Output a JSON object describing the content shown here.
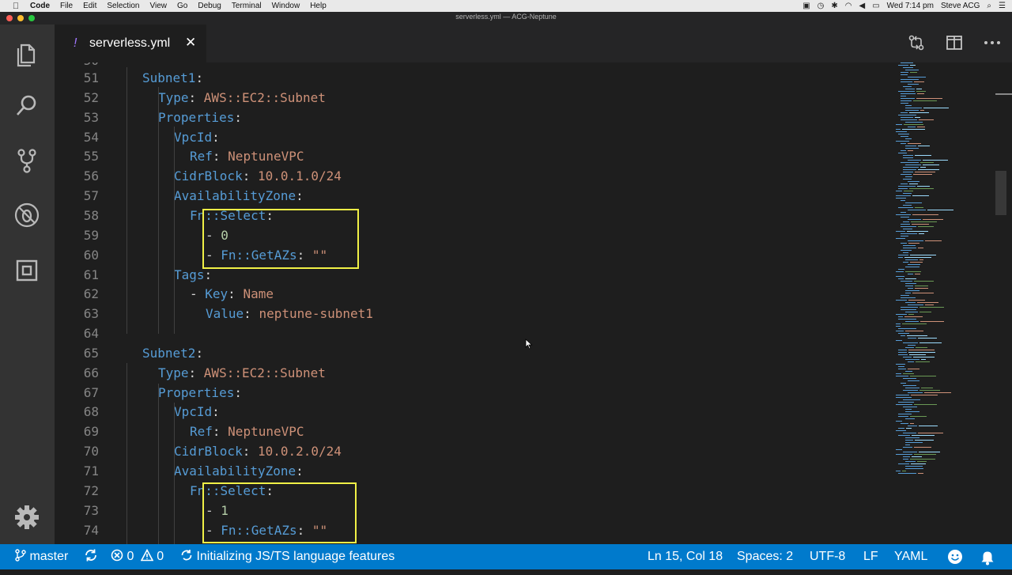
{
  "menubar": {
    "app": "Code",
    "items": [
      "File",
      "Edit",
      "Selection",
      "View",
      "Go",
      "Debug",
      "Terminal",
      "Window",
      "Help"
    ],
    "clock": "Wed 7:14 pm",
    "user": "Steve ACG"
  },
  "window": {
    "title": "serverless.yml — ACG-Neptune"
  },
  "tab": {
    "modified_mark": "!",
    "name": "serverless.yml",
    "close": "✕"
  },
  "editor": {
    "lines": [
      {
        "no": "51",
        "indent": 2,
        "tokens": [
          {
            "t": "Subnet1",
            "c": "k"
          },
          {
            "t": ":",
            "c": "p"
          }
        ]
      },
      {
        "no": "52",
        "indent": 3,
        "tokens": [
          {
            "t": "Type",
            "c": "k"
          },
          {
            "t": ": ",
            "c": "p"
          },
          {
            "t": "AWS::EC2::Subnet",
            "c": "s"
          }
        ]
      },
      {
        "no": "53",
        "indent": 3,
        "tokens": [
          {
            "t": "Properties",
            "c": "k"
          },
          {
            "t": ":",
            "c": "p"
          }
        ]
      },
      {
        "no": "54",
        "indent": 4,
        "tokens": [
          {
            "t": "VpcId",
            "c": "k"
          },
          {
            "t": ":",
            "c": "p"
          }
        ]
      },
      {
        "no": "55",
        "indent": 5,
        "tokens": [
          {
            "t": "Ref",
            "c": "k"
          },
          {
            "t": ": ",
            "c": "p"
          },
          {
            "t": "NeptuneVPC",
            "c": "s"
          }
        ]
      },
      {
        "no": "56",
        "indent": 4,
        "tokens": [
          {
            "t": "CidrBlock",
            "c": "k"
          },
          {
            "t": ": ",
            "c": "p"
          },
          {
            "t": "10.0.1.0/24",
            "c": "s"
          }
        ]
      },
      {
        "no": "57",
        "indent": 4,
        "tokens": [
          {
            "t": "AvailabilityZone",
            "c": "k"
          },
          {
            "t": ":",
            "c": "p"
          }
        ]
      },
      {
        "no": "58",
        "indent": 5,
        "tokens": [
          {
            "t": "Fn::Select",
            "c": "k"
          },
          {
            "t": ":",
            "c": "p"
          }
        ]
      },
      {
        "no": "59",
        "indent": 6,
        "tokens": [
          {
            "t": "- ",
            "c": "p"
          },
          {
            "t": "0",
            "c": "n"
          }
        ]
      },
      {
        "no": "60",
        "indent": 6,
        "tokens": [
          {
            "t": "- ",
            "c": "p"
          },
          {
            "t": "Fn::GetAZs",
            "c": "k"
          },
          {
            "t": ": ",
            "c": "p"
          },
          {
            "t": "\"\"",
            "c": "s"
          }
        ]
      },
      {
        "no": "61",
        "indent": 4,
        "tokens": [
          {
            "t": "Tags",
            "c": "k"
          },
          {
            "t": ":",
            "c": "p"
          }
        ]
      },
      {
        "no": "62",
        "indent": 5,
        "tokens": [
          {
            "t": "- ",
            "c": "p"
          },
          {
            "t": "Key",
            "c": "k"
          },
          {
            "t": ": ",
            "c": "p"
          },
          {
            "t": "Name",
            "c": "s"
          }
        ]
      },
      {
        "no": "63",
        "indent": 6,
        "tokens": [
          {
            "t": "Value",
            "c": "k"
          },
          {
            "t": ": ",
            "c": "p"
          },
          {
            "t": "neptune-subnet1",
            "c": "s"
          }
        ]
      },
      {
        "no": "64",
        "indent": 0,
        "tokens": []
      },
      {
        "no": "65",
        "indent": 2,
        "tokens": [
          {
            "t": "Subnet2",
            "c": "k"
          },
          {
            "t": ":",
            "c": "p"
          }
        ]
      },
      {
        "no": "66",
        "indent": 3,
        "tokens": [
          {
            "t": "Type",
            "c": "k"
          },
          {
            "t": ": ",
            "c": "p"
          },
          {
            "t": "AWS::EC2::Subnet",
            "c": "s"
          }
        ]
      },
      {
        "no": "67",
        "indent": 3,
        "tokens": [
          {
            "t": "Properties",
            "c": "k"
          },
          {
            "t": ":",
            "c": "p"
          }
        ]
      },
      {
        "no": "68",
        "indent": 4,
        "tokens": [
          {
            "t": "VpcId",
            "c": "k"
          },
          {
            "t": ":",
            "c": "p"
          }
        ]
      },
      {
        "no": "69",
        "indent": 5,
        "tokens": [
          {
            "t": "Ref",
            "c": "k"
          },
          {
            "t": ": ",
            "c": "p"
          },
          {
            "t": "NeptuneVPC",
            "c": "s"
          }
        ]
      },
      {
        "no": "70",
        "indent": 4,
        "tokens": [
          {
            "t": "CidrBlock",
            "c": "k"
          },
          {
            "t": ": ",
            "c": "p"
          },
          {
            "t": "10.0.2.0/24",
            "c": "s"
          }
        ]
      },
      {
        "no": "71",
        "indent": 4,
        "tokens": [
          {
            "t": "AvailabilityZone",
            "c": "k"
          },
          {
            "t": ":",
            "c": "p"
          }
        ]
      },
      {
        "no": "72",
        "indent": 5,
        "tokens": [
          {
            "t": "Fn::Select",
            "c": "k"
          },
          {
            "t": ":",
            "c": "p"
          }
        ]
      },
      {
        "no": "73",
        "indent": 6,
        "tokens": [
          {
            "t": "- ",
            "c": "p"
          },
          {
            "t": "1",
            "c": "n"
          }
        ]
      },
      {
        "no": "74",
        "indent": 6,
        "tokens": [
          {
            "t": "- ",
            "c": "p"
          },
          {
            "t": "Fn::GetAZs",
            "c": "k"
          },
          {
            "t": ": ",
            "c": "p"
          },
          {
            "t": "\"\"",
            "c": "s"
          }
        ]
      }
    ]
  },
  "statusbar": {
    "branch": "master",
    "errors": "0",
    "warnings": "0",
    "task": "Initializing JS/TS language features",
    "position": "Ln 15, Col 18",
    "spaces": "Spaces: 2",
    "encoding": "UTF-8",
    "eol": "LF",
    "language": "YAML"
  },
  "colors": {
    "keyword": "#569cd6",
    "string": "#ce9178",
    "number": "#b5cea8",
    "highlight_box": "#f0f046",
    "statusbar": "#007acc"
  },
  "icons": [
    "explorer-icon",
    "search-icon",
    "source-control-icon",
    "debug-icon",
    "extensions-icon",
    "settings-gear-icon",
    "compare-changes-icon",
    "split-editor-icon",
    "more-actions-icon",
    "git-branch-icon",
    "sync-icon",
    "error-icon",
    "warning-icon",
    "smiley-feedback-icon",
    "bell-icon"
  ]
}
